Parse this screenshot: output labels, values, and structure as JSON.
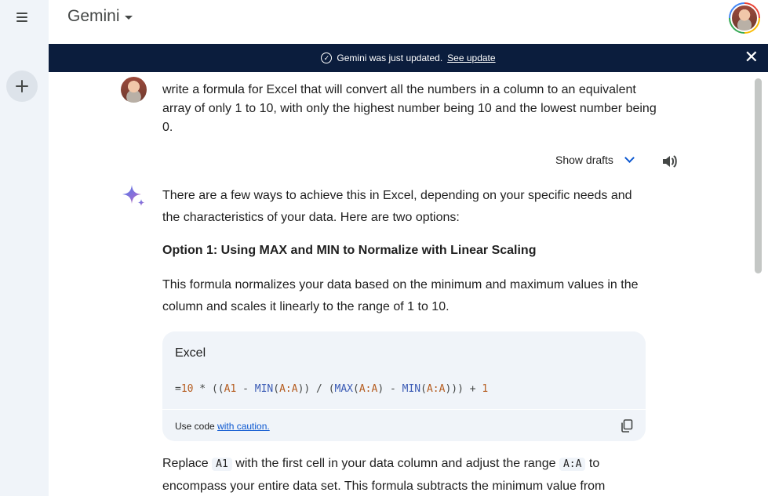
{
  "header": {
    "brand": "Gemini"
  },
  "banner": {
    "message": "Gemini was just updated.",
    "link": "See update",
    "close": "✕"
  },
  "conversation": {
    "prompt": "write a formula for Excel that will convert all the numbers in a column to an equivalent array of only 1 to 10, with only the highest number being 10 and the lowest number being 0.",
    "show_drafts": "Show drafts",
    "response": {
      "intro": "There are a few ways to achieve this in Excel, depending on your specific needs and the characteristics of your data. Here are two options:",
      "option1_heading": "Option 1: Using MAX and MIN to Normalize with Linear Scaling",
      "option1_desc": "This formula normalizes your data based on the minimum and maximum values in the column and scales it linearly to the range of 1 to 10.",
      "code": {
        "language": "Excel",
        "tokens": {
          "t1": "=",
          "t2": "10",
          "t3": " * ((",
          "t4": "A1",
          "t5": " - ",
          "t6": "MIN",
          "t7": "(",
          "t8": "A:A",
          "t9": ")) / (",
          "t10": "MAX",
          "t11": "(",
          "t12": "A:A",
          "t13": ") - ",
          "t14": "MIN",
          "t15": "(",
          "t16": "A:A",
          "t17": "))) + ",
          "t18": "1"
        },
        "footer_prefix": "Use code ",
        "footer_link": "with caution."
      },
      "replace": {
        "before": "Replace ",
        "code1": "A1",
        "middle": " with the first cell in your data column and adjust the range ",
        "code2": "A:A",
        "after": " to encompass your entire data set. This formula subtracts the minimum value from"
      }
    }
  }
}
